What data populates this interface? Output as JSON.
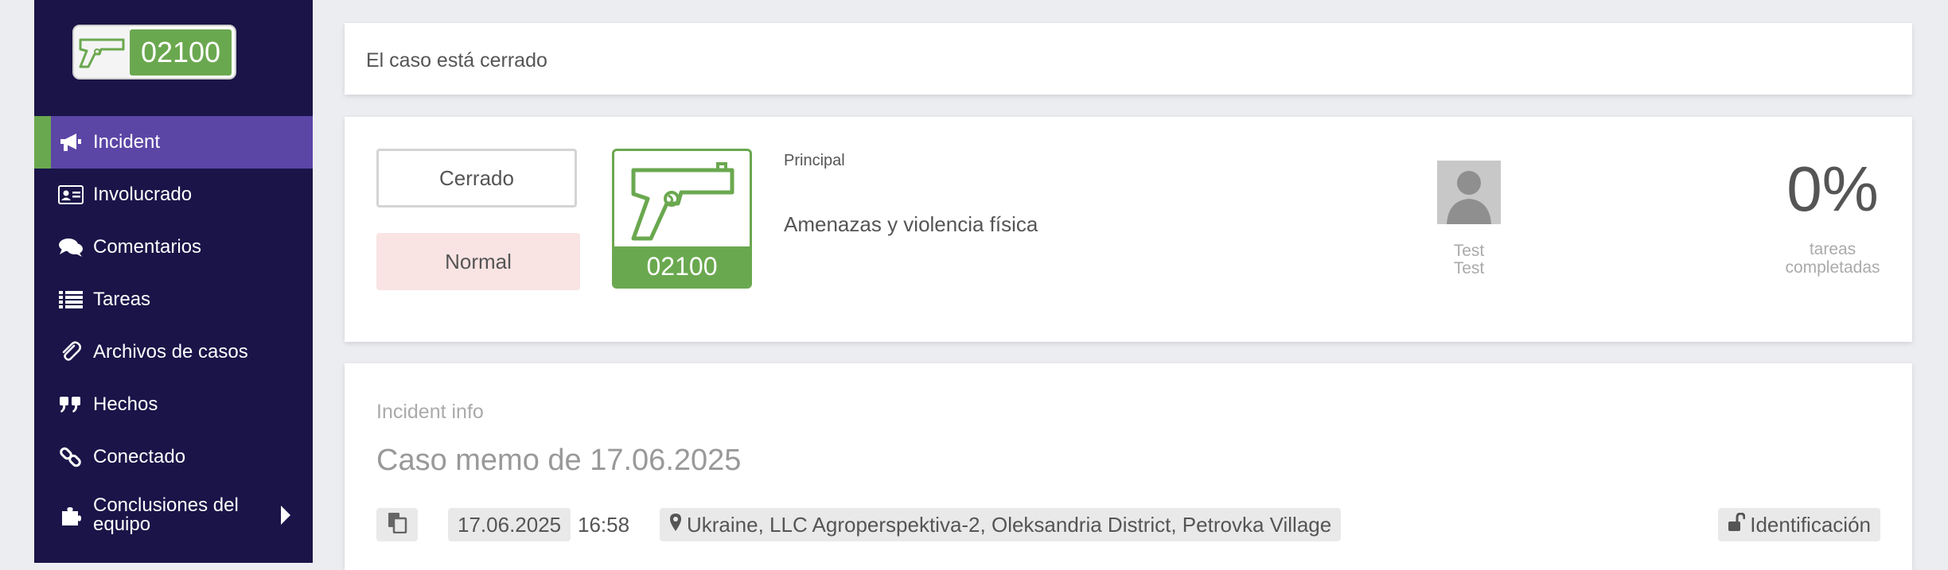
{
  "logo": {
    "code": "02100",
    "icon": "pistol-icon"
  },
  "sidebar": {
    "items": [
      {
        "label": "Incident",
        "icon": "megaphone-icon",
        "active": true
      },
      {
        "label": "Involucrado",
        "icon": "id-card-icon"
      },
      {
        "label": "Comentarios",
        "icon": "comments-icon"
      },
      {
        "label": "Tareas",
        "icon": "list-icon"
      },
      {
        "label": "Archivos de casos",
        "icon": "paperclip-icon"
      },
      {
        "label": "Hechos",
        "icon": "quote-icon"
      },
      {
        "label": "Conectado",
        "icon": "link-icon"
      },
      {
        "label": "Conclusiones del equipo",
        "icon": "puzzle-icon",
        "has_submenu": true
      }
    ]
  },
  "status_banner": {
    "text": "El caso está cerrado"
  },
  "case": {
    "status": "Cerrado",
    "priority": "Normal",
    "category_code": "02100",
    "category_label": "Principal",
    "category_name": "Amenazas y violencia física",
    "assignee": "Test\nTest",
    "tasks_percent": "0%",
    "tasks_label": "tareas\ncompletadas"
  },
  "info": {
    "section_label": "Incident info",
    "title": "Caso memo de 17.06.2025",
    "date": "17.06.2025",
    "time": "16:58",
    "location": "Ukraine, LLC Agroperspektiva-2, Oleksandria District, Petrovka Village",
    "identification": "Identificación"
  },
  "colors": {
    "sidebar": "#1a1448",
    "active_item": "#5b46a6",
    "accent_green": "#6aa84f",
    "priority_bg": "#f9e3e3"
  }
}
